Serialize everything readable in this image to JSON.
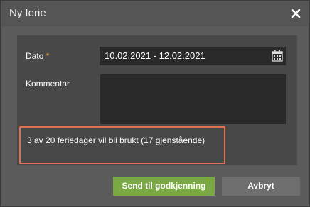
{
  "dialog": {
    "title": "Ny ferie",
    "close_icon": "close-x-icon"
  },
  "form": {
    "date_label": "Dato",
    "required_marker": "*",
    "date_value": "10.02.2021 - 12.02.2021",
    "date_icon": "calendar-icon",
    "comment_label": "Kommentar",
    "comment_value": ""
  },
  "info": {
    "text": "3 av 20 feriedager vil bli brukt (17 gjenstående)",
    "highlight_color": "#e07050"
  },
  "buttons": {
    "send_label": "Send til godkjenning",
    "cancel_label": "Avbryt"
  },
  "colors": {
    "accent_green": "#7aa845",
    "secondary_gray": "#6e6e6e",
    "required_orange": "#f0a030"
  }
}
